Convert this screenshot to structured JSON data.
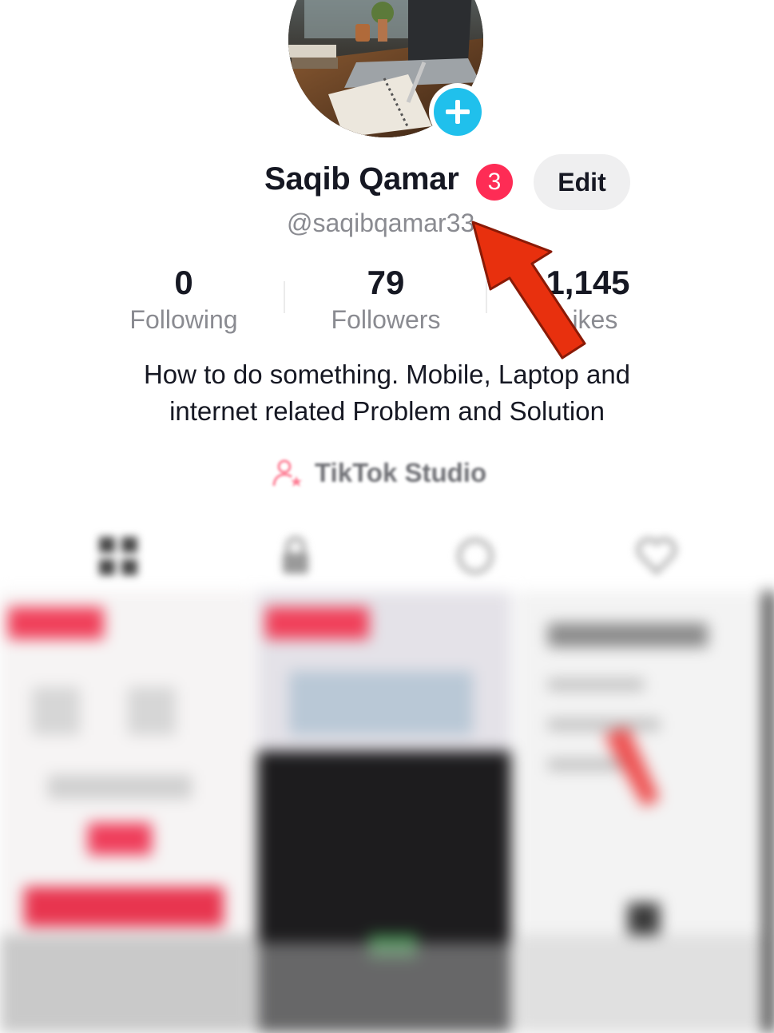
{
  "profile": {
    "display_name": "Saqib Qamar",
    "notification_count": "3",
    "edit_label": "Edit",
    "username": "@saqibqamar33",
    "avatar_add_icon": "plus-icon"
  },
  "stats": [
    {
      "value": "0",
      "label": "Following"
    },
    {
      "value": "79",
      "label": "Followers"
    },
    {
      "value": "1,145",
      "label": "Likes"
    }
  ],
  "bio": {
    "line1": "How to do something. Mobile, Laptop and",
    "line2": "internet related Problem and Solution"
  },
  "studio": {
    "label": "TikTok Studio",
    "icon": "person-star-icon"
  },
  "tabs": [
    {
      "icon": "videos-grid-icon"
    },
    {
      "icon": "lock-icon"
    },
    {
      "icon": "repost-icon"
    },
    {
      "icon": "heart-icon"
    }
  ],
  "colors": {
    "accent": "#fe2c55",
    "add_button": "#20c0ec",
    "annotation_arrow": "#e8300e"
  }
}
